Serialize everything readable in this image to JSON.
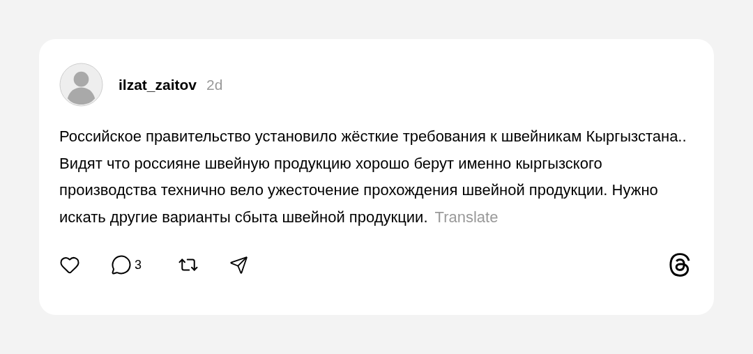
{
  "post": {
    "username": "ilzat_zaitov",
    "time": "2d",
    "text": "Российское правительство установило жёсткие требования к швейникам Кыргызстана.. Видят что россияне швейную продукцию хорошо берут именно кыргызского производства технично вело ужесточение прохождения швейной продукции. Нужно искать другие варианты сбыта швейной продукции.",
    "translate": "Translate",
    "comment_count": "3"
  }
}
